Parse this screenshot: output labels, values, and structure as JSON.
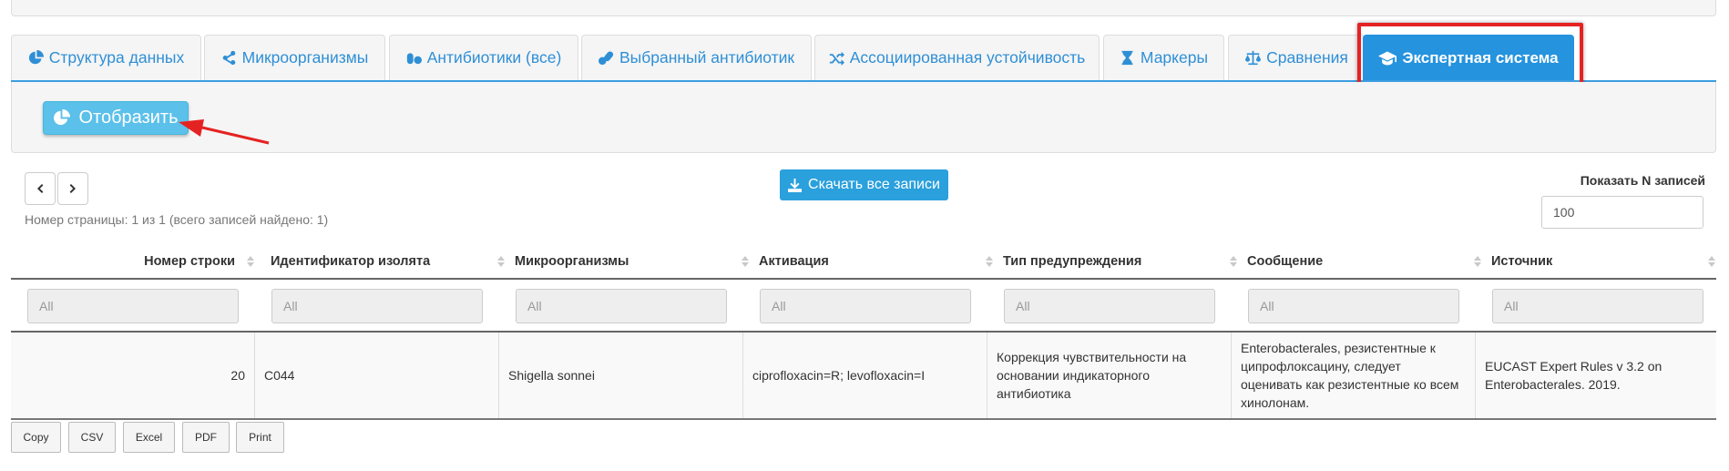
{
  "tabs": [
    {
      "label": "Структура данных",
      "icon": "pie-chart-icon"
    },
    {
      "label": "Микроорганизмы",
      "icon": "share-nodes-icon"
    },
    {
      "label": "Антибиотики (все)",
      "icon": "pills-icon"
    },
    {
      "label": "Выбранный антибиотик",
      "icon": "capsules-icon"
    },
    {
      "label": "Ассоциированная устойчивость",
      "icon": "random-icon"
    },
    {
      "label": "Маркеры",
      "icon": "hourglass-icon"
    },
    {
      "label": "Сравнения",
      "icon": "balance-scale-icon"
    },
    {
      "label": "Экспертная система",
      "icon": "graduation-cap-icon",
      "active": true
    }
  ],
  "panel": {
    "show_button": "Отобразить"
  },
  "pager": {
    "info": "Номер страницы: 1 из 1 (всего записей найдено: 1)"
  },
  "download_button": "Скачать все записи",
  "page_length": {
    "label": "Показать N записей",
    "value": "100"
  },
  "table": {
    "columns": [
      "Номер строки",
      "Идентификатор изолята",
      "Микроорганизмы",
      "Активация",
      "Тип предупреждения",
      "Сообщение",
      "Источник"
    ],
    "filter_placeholder": "All",
    "rows": [
      [
        "20",
        "C044",
        "Shigella sonnei",
        "ciprofloxacin=R; levofloxacin=I",
        "Коррекция чувствительности на основании индикаторного антибиотика",
        "Enterobacterales, резистентные к ципрофлоксацину, следует оценивать как резистентные ко всем хинолонам.",
        "EUCAST Expert Rules v 3.2 on Enterobacterales. 2019."
      ]
    ]
  },
  "export_buttons": [
    "Copy",
    "CSV",
    "Excel",
    "PDF",
    "Print"
  ],
  "colors": {
    "accent": "#2593de",
    "highlight": "#e52222",
    "info_button": "#5bc0ea"
  }
}
